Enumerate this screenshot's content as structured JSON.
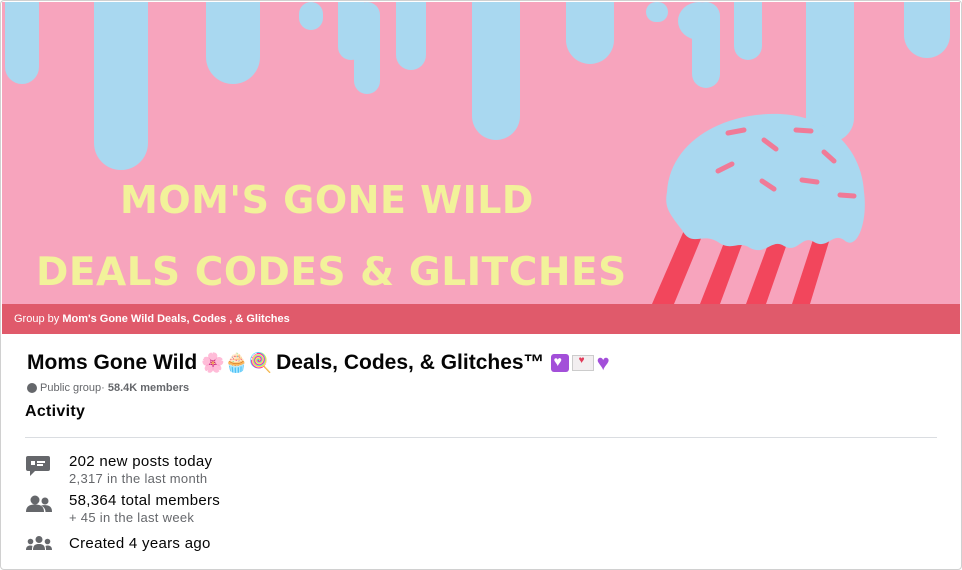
{
  "cover": {
    "line1": "MOM'S GONE WILD",
    "line2": "DEALS CODES & GLITCHES",
    "colors": {
      "background": "#f7a4bd",
      "drips": "#a9d8f0",
      "text": "#f2f29a",
      "stripes": "#f2465c"
    }
  },
  "group_by": {
    "prefix": "Group by ",
    "owner": "Mom's Gone Wild Deals, Codes , & Glitches"
  },
  "group": {
    "name": "Moms Gone Wild",
    "emoji": "🌸🧁🍭",
    "name_suffix": "Deals, Codes, & Glitches™",
    "privacy": "Public group",
    "separator": " · ",
    "members": "58.4K members"
  },
  "activity": {
    "heading": "Activity",
    "items": [
      {
        "icon": "chat-icon",
        "primary": "202 new posts today",
        "secondary": "2,317 in the last month"
      },
      {
        "icon": "people-icon",
        "primary": "58,364 total members",
        "secondary": "+ 45 in the last week"
      },
      {
        "icon": "group-icon",
        "primary": "Created 4 years ago",
        "secondary": ""
      }
    ]
  }
}
